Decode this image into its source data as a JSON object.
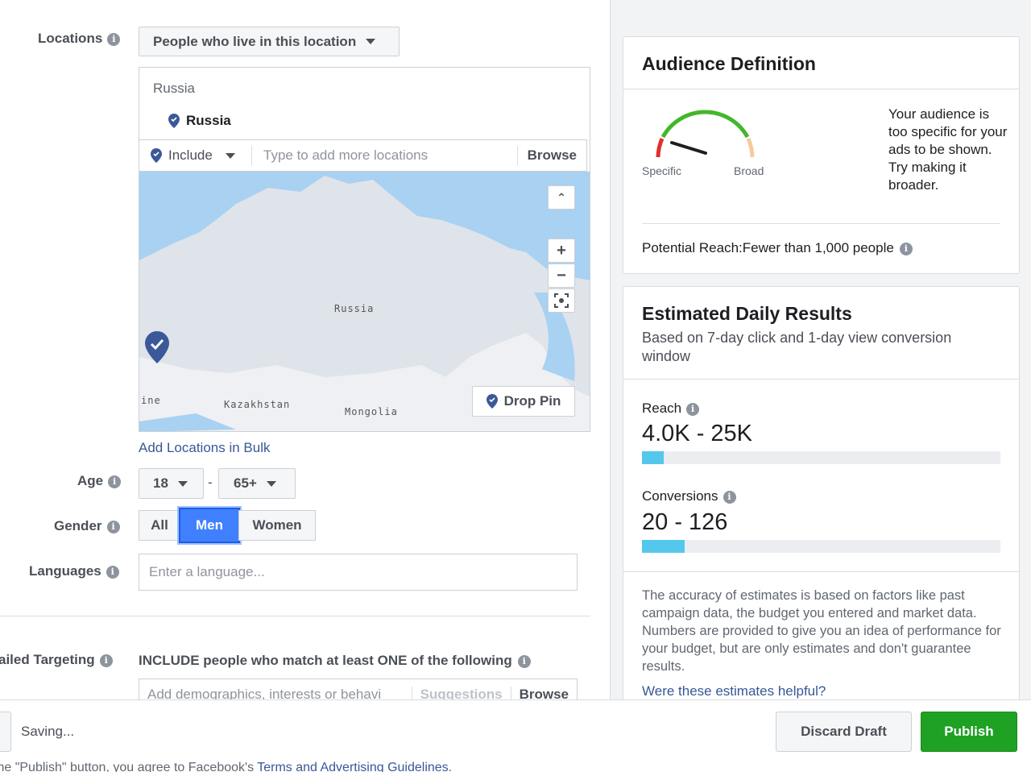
{
  "locations": {
    "label": "Locations",
    "type_dropdown": "People who live in this location",
    "search_text": "Russia",
    "selected": "Russia",
    "include_label": "Include",
    "add_placeholder": "Type to add more locations",
    "browse": "Browse",
    "map": {
      "labels": [
        "Russia",
        "Kazakhstan",
        "Mongolia",
        "ine"
      ],
      "drop_pin": "Drop Pin",
      "zoom_in": "+",
      "zoom_out": "−",
      "collapse": "⌃"
    },
    "bulk_link": "Add Locations in Bulk"
  },
  "age": {
    "label": "Age",
    "min": "18",
    "separator": "-",
    "max": "65+"
  },
  "gender": {
    "label": "Gender",
    "options": [
      "All",
      "Men",
      "Women"
    ],
    "selected": "Men"
  },
  "languages": {
    "label": "Languages",
    "placeholder": "Enter a language..."
  },
  "detailed_targeting": {
    "label": "ailed Targeting",
    "description": "INCLUDE people who match at least ONE of the following",
    "placeholder": "Add demographics, interests or behavi",
    "suggestions": "Suggestions",
    "browse": "Browse"
  },
  "audience_definition": {
    "title": "Audience Definition",
    "gauge_left": "Specific",
    "gauge_right": "Broad",
    "message": "Your audience is too specific for your ads to be shown. Try making it broader.",
    "potential_reach": "Potential Reach:Fewer than 1,000 people"
  },
  "estimated_results": {
    "title": "Estimated Daily Results",
    "subtitle": "Based on 7-day click and 1-day view conversion window",
    "reach_label": "Reach",
    "reach_value": "4.0K - 25K",
    "reach_fill": 0.06,
    "conversions_label": "Conversions",
    "conversions_value": "20 - 126",
    "conversions_fill": 0.12,
    "accuracy_note": "The accuracy of estimates is based on factors like past campaign data, the budget you entered and market data. Numbers are provided to give you an idea of performance for your budget, but are only estimates and don't guarantee results.",
    "helpful_link": "Were these estimates helpful?"
  },
  "footer": {
    "saving": "Saving...",
    "terms_prefix": "the \"Publish\" button, you agree to Facebook's ",
    "terms_link": "Terms and Advertising Guidelines",
    "terms_suffix": ".",
    "discard": "Discard Draft",
    "publish": "Publish"
  },
  "colors": {
    "accent": "#4080ff",
    "link": "#385898",
    "publish_green": "#1fa123",
    "bar_fill": "#54c7ec",
    "pin_blue": "#3b5998"
  }
}
